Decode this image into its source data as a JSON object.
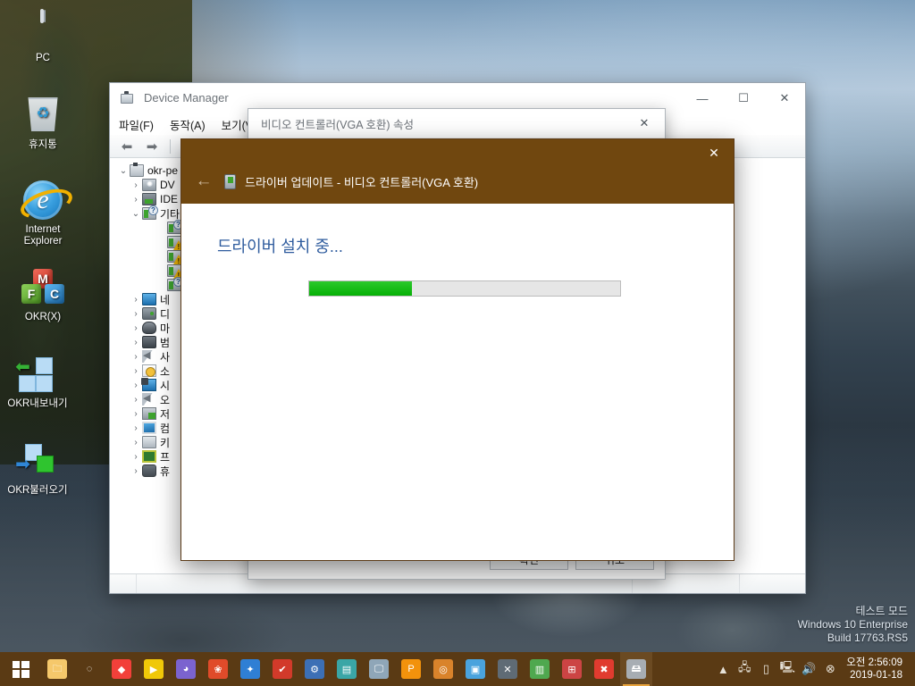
{
  "desktop": {
    "icons": [
      {
        "name": "pc",
        "label": "PC"
      },
      {
        "name": "recycle-bin",
        "label": "휴지통"
      },
      {
        "name": "internet-explorer",
        "label": "Internet Explorer"
      },
      {
        "name": "okr-x",
        "label": "OKR(X)"
      },
      {
        "name": "okr-export",
        "label": "OKR내보내기"
      },
      {
        "name": "okr-import",
        "label": "OKR불러오기"
      }
    ]
  },
  "watermark": {
    "line1": "테스트 모드",
    "line2": "Windows 10 Enterprise",
    "line3": "Build  17763.RS5"
  },
  "device_manager": {
    "title": "Device Manager",
    "window_controls": {
      "minimize": "—",
      "maximize": "☐",
      "close": "✕"
    },
    "menus": [
      "파일(F)",
      "동작(A)",
      "보기(V)"
    ],
    "toolbar": {
      "back": "⬅",
      "forward": "➡",
      "properties": "properties-icon"
    },
    "tree": [
      {
        "label": "okr-pe",
        "icon": "computer",
        "level": 0,
        "expanded": true,
        "chevron": "⌄"
      },
      {
        "label": "DV",
        "icon": "dvd",
        "level": 1,
        "expanded": false,
        "chevron": "›"
      },
      {
        "label": "IDE",
        "icon": "ide",
        "level": 1,
        "expanded": false,
        "chevron": "›"
      },
      {
        "label": "기타",
        "icon": "other",
        "level": 1,
        "expanded": true,
        "chevron": "⌄",
        "badge": "question"
      },
      {
        "label": "",
        "icon": "dev",
        "level": 2,
        "expanded": false,
        "chevron": "",
        "badge": "question"
      },
      {
        "label": "",
        "icon": "dev",
        "level": 2,
        "expanded": false,
        "chevron": "",
        "badge": "warning"
      },
      {
        "label": "",
        "icon": "dev",
        "level": 2,
        "expanded": false,
        "chevron": "",
        "badge": "warning"
      },
      {
        "label": "",
        "icon": "dev",
        "level": 2,
        "expanded": false,
        "chevron": "",
        "badge": "warning"
      },
      {
        "label": "",
        "icon": "dev",
        "level": 2,
        "expanded": false,
        "chevron": "",
        "badge": "question"
      },
      {
        "label": "네",
        "icon": "net",
        "level": 1,
        "expanded": false,
        "chevron": "›"
      },
      {
        "label": "디",
        "icon": "disk",
        "level": 1,
        "expanded": false,
        "chevron": "›"
      },
      {
        "label": "마",
        "icon": "mouse",
        "level": 1,
        "expanded": false,
        "chevron": "›"
      },
      {
        "label": "범",
        "icon": "usb",
        "level": 1,
        "expanded": false,
        "chevron": "›"
      },
      {
        "label": "사",
        "icon": "sound",
        "level": 1,
        "expanded": false,
        "chevron": "›"
      },
      {
        "label": "소",
        "icon": "software",
        "level": 1,
        "expanded": false,
        "chevron": "›"
      },
      {
        "label": "시",
        "icon": "system",
        "level": 1,
        "expanded": false,
        "chevron": "›"
      },
      {
        "label": "오",
        "icon": "sound",
        "level": 1,
        "expanded": false,
        "chevron": "›"
      },
      {
        "label": "저",
        "icon": "storage",
        "level": 1,
        "expanded": false,
        "chevron": "›"
      },
      {
        "label": "컴",
        "icon": "monitor",
        "level": 1,
        "expanded": false,
        "chevron": "›"
      },
      {
        "label": "키",
        "icon": "keyboard",
        "level": 1,
        "expanded": false,
        "chevron": "›"
      },
      {
        "label": "프",
        "icon": "cpu",
        "level": 1,
        "expanded": false,
        "chevron": "›"
      },
      {
        "label": "휴",
        "icon": "hid",
        "level": 1,
        "expanded": false,
        "chevron": "›"
      }
    ]
  },
  "properties_dialog": {
    "title": "비디오 컨트롤러(VGA 호환) 속성",
    "close_label": "✕",
    "buttons": [
      "확인",
      "취소"
    ]
  },
  "wizard": {
    "close_label": "✕",
    "back_label": "←",
    "header_icon": "device-icon",
    "header_title": "드라이버 업데이트 - 비디오 컨트롤러(VGA 호환)",
    "heading": "드라이버 설치 중...",
    "progress_percent": 33,
    "accent_color": "#70470f",
    "progress_color": "#06b006"
  },
  "taskbar": {
    "start_label": "start-button",
    "items": [
      {
        "name": "file-explorer",
        "glyph": "🗀",
        "color": "#f5c86b"
      },
      {
        "name": "cortana",
        "glyph": "◌",
        "color": "transparent"
      },
      {
        "name": "everything",
        "glyph": "◆",
        "color": "#f2403a"
      },
      {
        "name": "potplayer",
        "glyph": "▶",
        "color": "#f0c808"
      },
      {
        "name": "disk-tool",
        "glyph": "◕",
        "color": "#7b63cf"
      },
      {
        "name": "photo-tool",
        "glyph": "❀",
        "color": "#e04b2a"
      },
      {
        "name": "ghost-explorer",
        "glyph": "✦",
        "color": "#2f7fd4"
      },
      {
        "name": "acronis",
        "glyph": "✔",
        "color": "#d23a2a"
      },
      {
        "name": "driver-tool",
        "glyph": "⚙",
        "color": "#3c6fb5"
      },
      {
        "name": "notepad-tool",
        "glyph": "▤",
        "color": "#3aa6a6"
      },
      {
        "name": "monitor-tool",
        "glyph": "🖵",
        "color": "#8fa6b8"
      },
      {
        "name": "partition-tool",
        "glyph": "P",
        "color": "#f2920c"
      },
      {
        "name": "cd-tool",
        "glyph": "◎",
        "color": "#d9832b"
      },
      {
        "name": "backup-tool",
        "glyph": "▣",
        "color": "#4aa3dd"
      },
      {
        "name": "settings-tool",
        "glyph": "✕",
        "color": "#5f6b75"
      },
      {
        "name": "script-tool",
        "glyph": "▥",
        "color": "#4fa84f"
      },
      {
        "name": "windows-tool",
        "glyph": "⊞",
        "color": "#c44"
      },
      {
        "name": "close-tool",
        "glyph": "✖",
        "color": "#e03b2f"
      },
      {
        "name": "device-manager",
        "glyph": "🖴",
        "color": "#a7adb3",
        "active": true
      }
    ],
    "tray": [
      {
        "name": "ahnlab-icon",
        "glyph": "▲"
      },
      {
        "name": "network-icon",
        "glyph": "🖧"
      },
      {
        "name": "usb-icon",
        "glyph": "▯"
      },
      {
        "name": "display-icon",
        "glyph": "🖳"
      },
      {
        "name": "volume-icon",
        "glyph": "🔊"
      },
      {
        "name": "action-icon",
        "glyph": "⊗"
      }
    ],
    "clock": {
      "time": "오전 2:56:09",
      "date": "2019-01-18"
    }
  }
}
